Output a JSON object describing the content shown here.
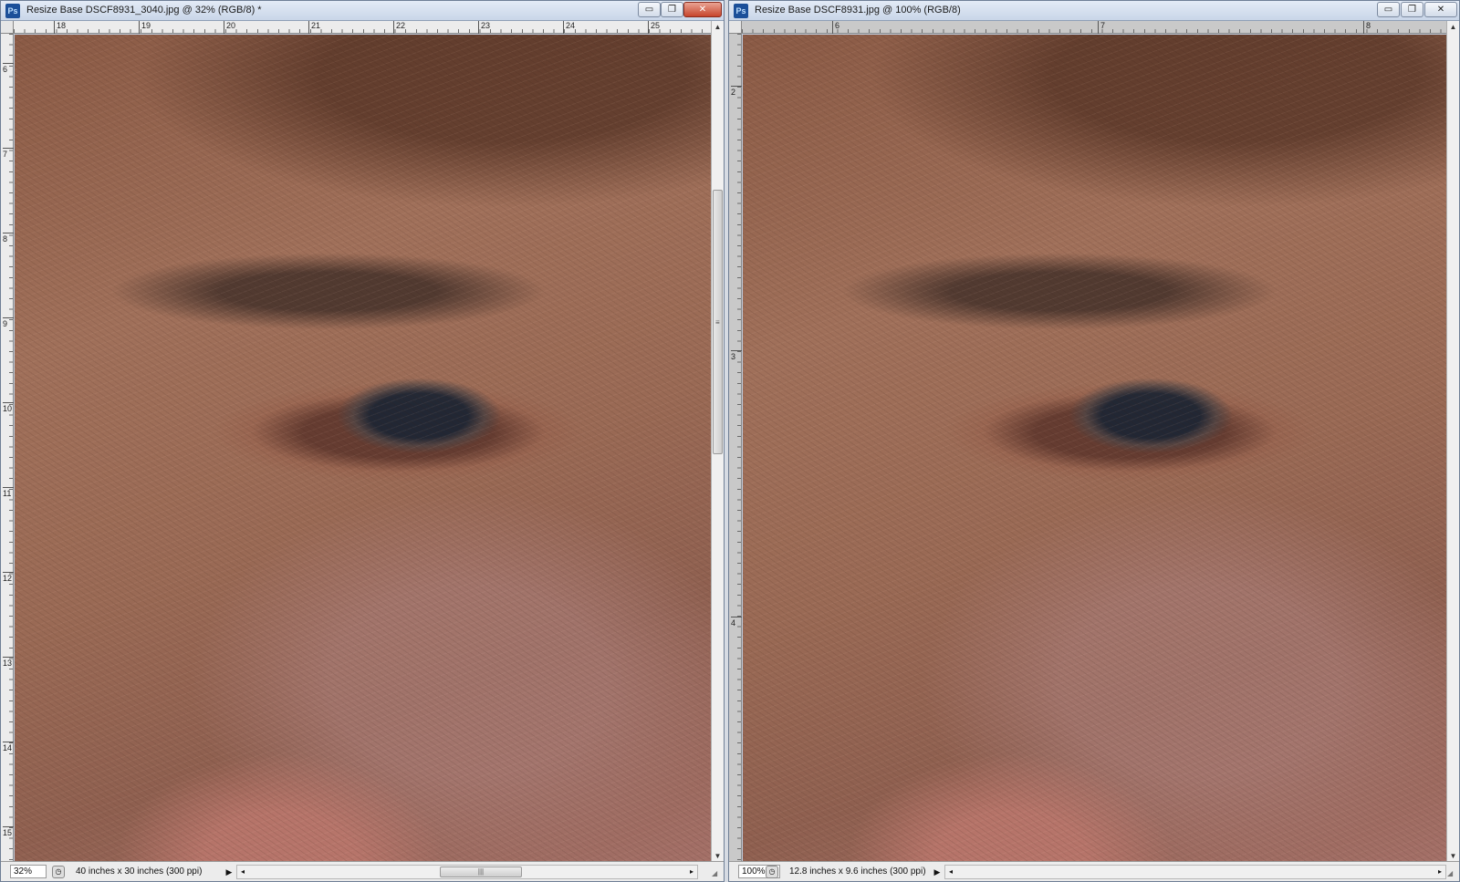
{
  "left_window": {
    "title": "Resize Base DSCF8931_3040.jpg @ 32% (RGB/8) *",
    "ruler_top": [
      "18",
      "19",
      "20",
      "21",
      "22",
      "23",
      "24",
      "25"
    ],
    "ruler_left": [
      "6",
      "7",
      "8",
      "9",
      "10",
      "11",
      "12",
      "13",
      "14",
      "15"
    ],
    "status": {
      "zoom": "32%",
      "doc_size": "40 inches x 30 inches (300 ppi)"
    }
  },
  "right_window": {
    "title": "Resize Base DSCF8931.jpg @ 100% (RGB/8)",
    "ruler_top": [
      "6",
      "7",
      "8"
    ],
    "ruler_left": [
      "2",
      "3",
      "4"
    ],
    "status": {
      "zoom": "100%",
      "doc_size": "12.8 inches x 9.6 inches (300 ppi)"
    }
  },
  "icons": {
    "app": "Ps",
    "minimize": "▭",
    "maximize": "❐",
    "close": "✕",
    "menu_arrow": "▶",
    "scroll_up": "▲",
    "scroll_down": "▼",
    "scroll_left": "◂",
    "scroll_right": "▸",
    "grip": "≡",
    "hgrip": "|||",
    "status_icon": "◷",
    "resize": "◢"
  }
}
